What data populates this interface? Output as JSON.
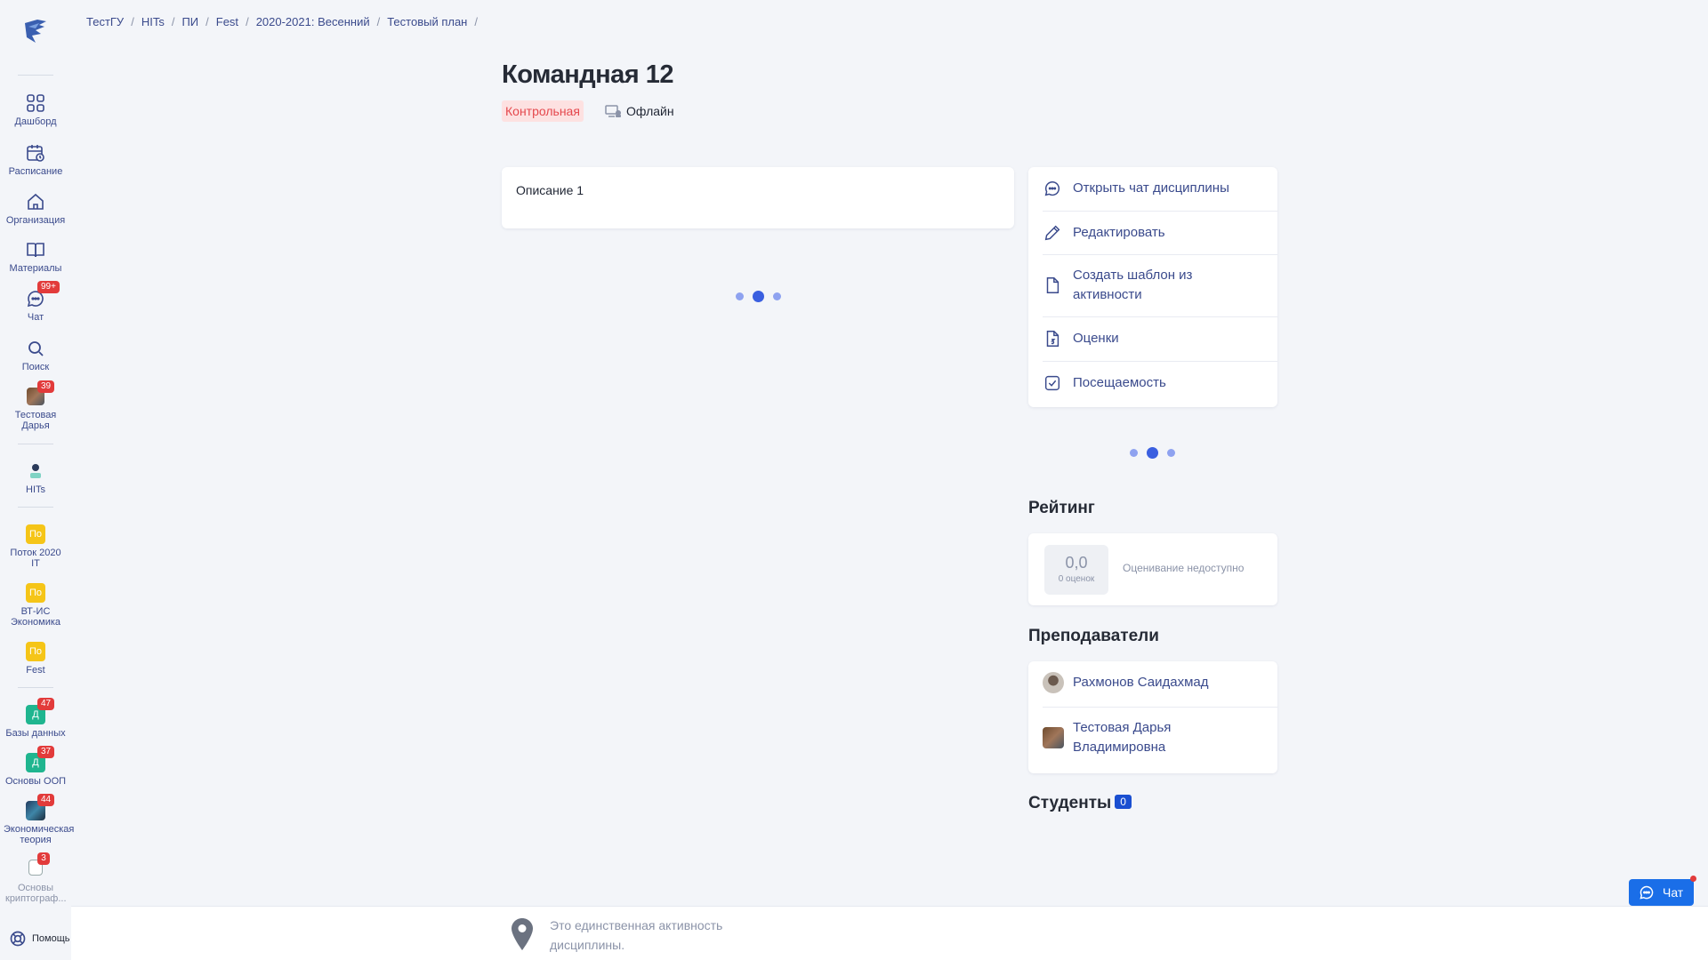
{
  "breadcrumb": [
    "ТестГУ",
    "HITs",
    "ПИ",
    "Fest",
    "2020-2021: Весенний",
    "Тестовый план"
  ],
  "sidebar": {
    "items": [
      {
        "label": "Дашборд",
        "icon": "dashboard-icon"
      },
      {
        "label": "Расписание",
        "icon": "calendar-icon"
      },
      {
        "label": "Организация",
        "icon": "home-icon"
      },
      {
        "label": "Материалы",
        "icon": "book-icon"
      },
      {
        "label": "Чат",
        "icon": "chat-icon",
        "badge": "99+"
      },
      {
        "label": "Поиск",
        "icon": "search-icon"
      },
      {
        "label": "Тестовая Дарья",
        "badge": "39"
      },
      {
        "label": "HITs"
      },
      {
        "label": "Поток 2020 IT",
        "avatar": "По"
      },
      {
        "label": "ВТ-ИС Экономика",
        "avatar": "По"
      },
      {
        "label": "Fest",
        "avatar": "По"
      },
      {
        "label": "Базы данных",
        "avatar": "Д",
        "badge": "47"
      },
      {
        "label": "Основы ООП",
        "avatar": "Д",
        "badge": "37"
      },
      {
        "label": "Экономическая теория",
        "badge": "44"
      },
      {
        "label": "Основы криптограф...",
        "badge": "3"
      }
    ],
    "help": "Помощь"
  },
  "title": "Командная 12",
  "tags": {
    "type": "Контрольная",
    "mode": "Офлайн"
  },
  "description": "Описание 1",
  "actions": [
    {
      "label": "Открыть чат дисциплины",
      "icon": "chat-icon"
    },
    {
      "label": "Редактировать",
      "icon": "pencil-icon"
    },
    {
      "label": "Создать шаблон из активности",
      "icon": "file-icon"
    },
    {
      "label": "Оценки",
      "icon": "grade-file-icon"
    },
    {
      "label": "Посещаемость",
      "icon": "checkbox-icon"
    }
  ],
  "rating": {
    "heading": "Рейтинг",
    "score": "0,0",
    "count": "0 оценок",
    "note": "Оценивание недоступно"
  },
  "teachers": {
    "heading": "Преподаватели",
    "list": [
      "Рахмонов Саидахмад",
      "Тестовая Дарья Владимировна"
    ]
  },
  "students": {
    "heading": "Студенты",
    "count": "0"
  },
  "bottom": {
    "text": "Это единственная активность дисциплины."
  },
  "chat_button": "Чат",
  "colors": {
    "accent": "#3a4a8c",
    "primary": "#1a6ee8",
    "badge": "#e23b3b",
    "tag_bg": "#fde1e1",
    "tag_text": "#e5484d"
  }
}
